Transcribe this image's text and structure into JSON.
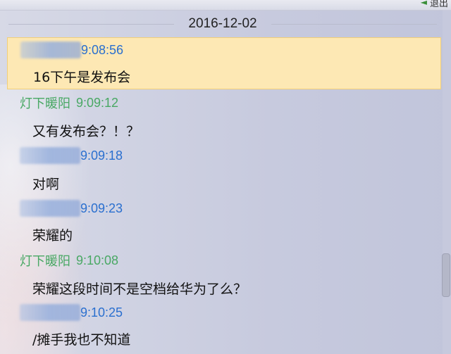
{
  "toolbar": {
    "exit_label": "退出",
    "exit_icon": "green-back-arrow-icon"
  },
  "date_separator": "2016-12-02",
  "messages": [
    {
      "sender": "",
      "sender_blurred": true,
      "time": "9:08:56",
      "time_color": "#2a6fcf",
      "text": "16下午是发布会",
      "highlight": true
    },
    {
      "sender": "灯下暖阳",
      "sender_blurred": false,
      "time": "9:09:12",
      "time_color": "#49a864",
      "text": "又有发布会？！？",
      "highlight": false
    },
    {
      "sender": "",
      "sender_blurred": true,
      "time": "9:09:18",
      "time_color": "#2a6fcf",
      "text": "对啊",
      "highlight": false
    },
    {
      "sender": "",
      "sender_blurred": true,
      "time": "9:09:23",
      "time_color": "#2a6fcf",
      "text": "荣耀的",
      "highlight": false
    },
    {
      "sender": "灯下暖阳",
      "sender_blurred": false,
      "time": "9:10:08",
      "time_color": "#49a864",
      "text": "荣耀这段时间不是空档给华为了么？",
      "highlight": false
    },
    {
      "sender": "",
      "sender_blurred": true,
      "time": "9:10:25",
      "time_color": "#2a6fcf",
      "text": "/摊手我也不知道",
      "highlight": false
    }
  ],
  "colors": {
    "highlight_bg": "#fde8b4",
    "self_name": "#49a864",
    "other_time": "#2a6fcf"
  }
}
